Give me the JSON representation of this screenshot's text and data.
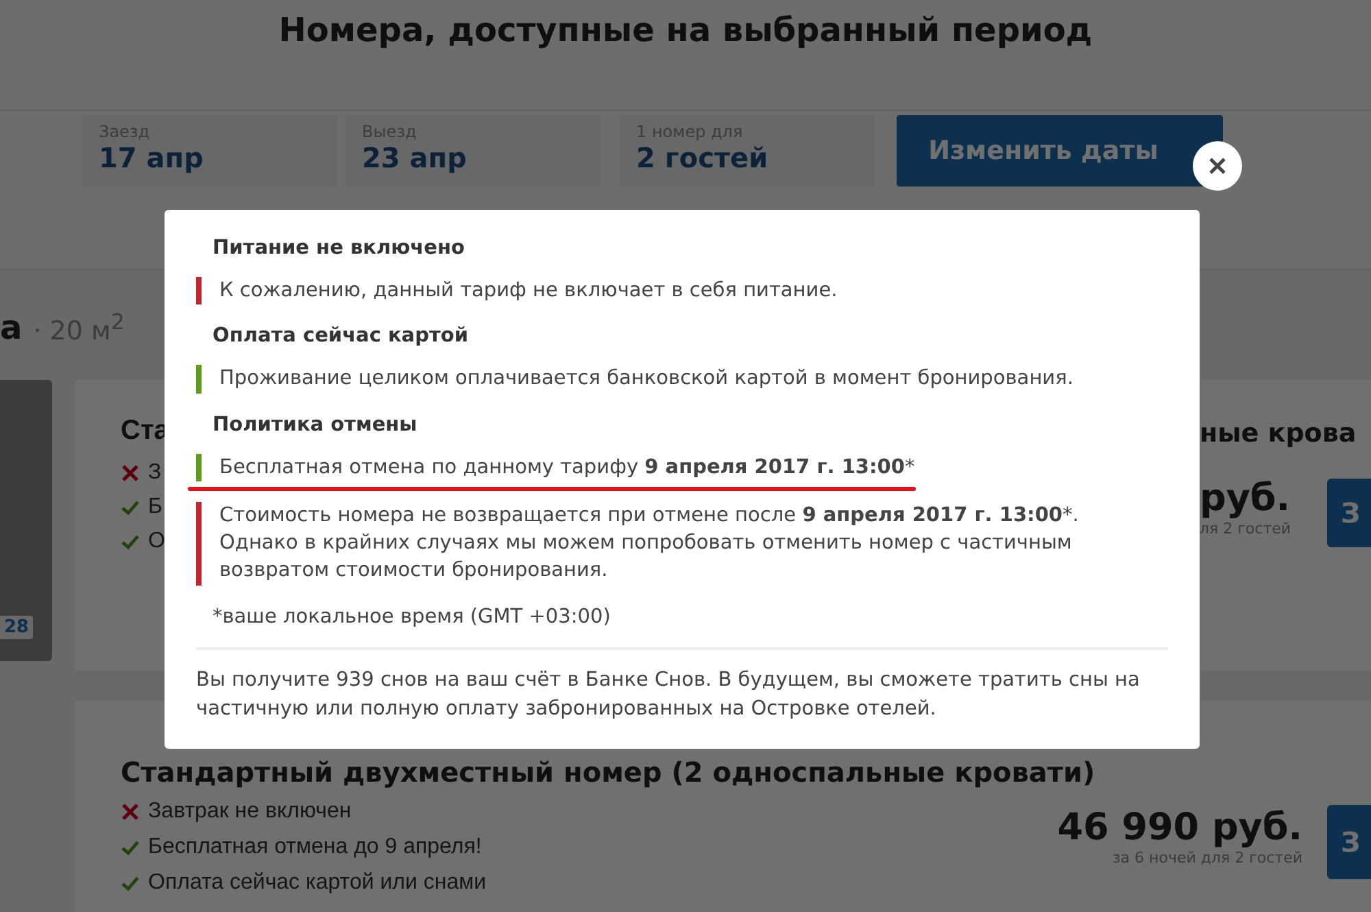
{
  "page_title": "Номера, доступные на выбранный период",
  "search": {
    "fields": [
      {
        "label": "Заезд",
        "value": "17 апр"
      },
      {
        "label": "Выезд",
        "value": "23 апр"
      },
      {
        "label": "1 номер для",
        "value": "2 гостей"
      }
    ],
    "button": "Изменить даты"
  },
  "room_1": {
    "heading": "а",
    "area": "· 20 м$^{2}$",
    "photo_count": "28",
    "title_left": "Ста",
    "title_right": "ные крова",
    "features": [
      {
        "kind": "excluded",
        "text": "З"
      },
      {
        "kind": "included",
        "text": "Б"
      },
      {
        "kind": "included",
        "text": "О"
      }
    ],
    "price": "руб.",
    "price_note": "ля 2 гостей",
    "book_button": "З"
  },
  "room_2": {
    "title": "Стандартный двухместный номер (2 односпальные кровати)",
    "features": [
      {
        "kind": "excluded",
        "text": "Завтрак не включен"
      },
      {
        "kind": "included",
        "text": "Бесплатная отмена до 9 апреля!"
      },
      {
        "kind": "included",
        "text": "Оплата сейчас картой или снами"
      }
    ],
    "price": "46 990 руб.",
    "price_note": "за 6 ночей для 2 гостей",
    "book_button": "З"
  },
  "modal": {
    "sections": [
      {
        "heading": "Питание не включено",
        "notes": [
          {
            "kind": "negative",
            "text": "К сожалению, данный тариф не включает в себя питание."
          }
        ]
      },
      {
        "heading": "Оплата сейчас картой",
        "notes": [
          {
            "kind": "positive",
            "text": "Проживание целиком оплачивается банковской картой в момент бронирования."
          }
        ]
      },
      {
        "heading": "Политика отмены",
        "notes": [
          {
            "kind": "positive",
            "underlined": true,
            "text": "Бесплатная отмена по данному тарифу **9 апреля 2017 г. 13:00***"
          },
          {
            "kind": "negative",
            "text": "Стоимость номера не возвращается при отмене после **9 апреля 2017 г. 13:00***. Однако в крайних случаях мы можем попробовать отменить номер с частичным возвратом стоимости бронирования."
          }
        ]
      }
    ],
    "footnote": "*ваше локальное время (GMT +03:00)",
    "bonus_text": "Вы получите 939 снов на ваш счёт в Банке Снов. В будущем, вы сможете тратить сны на частичную или полную оплату забронированных на Островке отелей."
  }
}
